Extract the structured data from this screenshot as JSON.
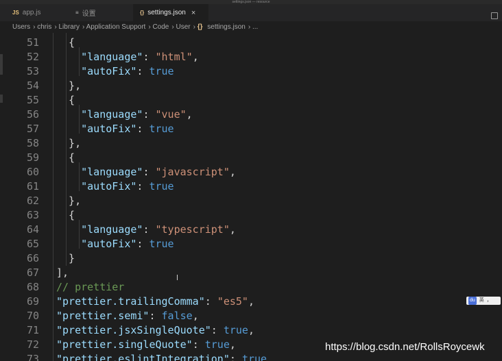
{
  "window": {
    "title": "settings.json — resource"
  },
  "tabs": [
    {
      "icon": "JS",
      "label": "app.js"
    },
    {
      "icon": "≡",
      "label": "设置"
    },
    {
      "icon": "{}",
      "label": "settings.json",
      "close": "×"
    }
  ],
  "breadcrumb": [
    "Users",
    "chris",
    "Library",
    "Application Support",
    "Code",
    "User",
    "settings.json",
    "..."
  ],
  "code": [
    {
      "n": "51",
      "t": [
        [
          "p",
          "  {"
        ]
      ]
    },
    {
      "n": "52",
      "t": [
        [
          "k",
          "    \"language\""
        ],
        [
          "p",
          ": "
        ],
        [
          "s",
          "\"html\""
        ],
        [
          "p",
          ","
        ]
      ]
    },
    {
      "n": "53",
      "t": [
        [
          "k",
          "    \"autoFix\""
        ],
        [
          "p",
          ": "
        ],
        [
          "b",
          "true"
        ]
      ]
    },
    {
      "n": "54",
      "t": [
        [
          "p",
          "  },"
        ]
      ]
    },
    {
      "n": "55",
      "t": [
        [
          "p",
          "  {"
        ]
      ]
    },
    {
      "n": "56",
      "t": [
        [
          "k",
          "    \"language\""
        ],
        [
          "p",
          ": "
        ],
        [
          "s",
          "\"vue\""
        ],
        [
          "p",
          ","
        ]
      ]
    },
    {
      "n": "57",
      "t": [
        [
          "k",
          "    \"autoFix\""
        ],
        [
          "p",
          ": "
        ],
        [
          "b",
          "true"
        ]
      ]
    },
    {
      "n": "58",
      "t": [
        [
          "p",
          "  },"
        ]
      ]
    },
    {
      "n": "59",
      "t": [
        [
          "p",
          "  {"
        ]
      ]
    },
    {
      "n": "60",
      "t": [
        [
          "k",
          "    \"language\""
        ],
        [
          "p",
          ": "
        ],
        [
          "s",
          "\"javascript\""
        ],
        [
          "p",
          ","
        ]
      ]
    },
    {
      "n": "61",
      "t": [
        [
          "k",
          "    \"autoFix\""
        ],
        [
          "p",
          ": "
        ],
        [
          "b",
          "true"
        ]
      ]
    },
    {
      "n": "62",
      "t": [
        [
          "p",
          "  },"
        ]
      ]
    },
    {
      "n": "63",
      "t": [
        [
          "p",
          "  {"
        ]
      ]
    },
    {
      "n": "64",
      "t": [
        [
          "k",
          "    \"language\""
        ],
        [
          "p",
          ": "
        ],
        [
          "s",
          "\"typescript\""
        ],
        [
          "p",
          ","
        ]
      ]
    },
    {
      "n": "65",
      "t": [
        [
          "k",
          "    \"autoFix\""
        ],
        [
          "p",
          ": "
        ],
        [
          "b",
          "true"
        ]
      ]
    },
    {
      "n": "66",
      "t": [
        [
          "p",
          "  }"
        ]
      ]
    },
    {
      "n": "67",
      "t": [
        [
          "p",
          "],"
        ]
      ]
    },
    {
      "n": "68",
      "t": [
        [
          "c",
          "// prettier"
        ]
      ]
    },
    {
      "n": "69",
      "t": [
        [
          "k",
          "\"prettier.trailingComma\""
        ],
        [
          "p",
          ": "
        ],
        [
          "s",
          "\"es5\""
        ],
        [
          "p",
          ","
        ]
      ]
    },
    {
      "n": "70",
      "t": [
        [
          "k",
          "\"prettier.semi\""
        ],
        [
          "p",
          ": "
        ],
        [
          "b",
          "false"
        ],
        [
          "p",
          ","
        ]
      ]
    },
    {
      "n": "71",
      "t": [
        [
          "k",
          "\"prettier.jsxSingleQuote\""
        ],
        [
          "p",
          ": "
        ],
        [
          "b",
          "true"
        ],
        [
          "p",
          ","
        ]
      ]
    },
    {
      "n": "72",
      "t": [
        [
          "k",
          "\"prettier.singleQuote\""
        ],
        [
          "p",
          ": "
        ],
        [
          "b",
          "true"
        ],
        [
          "p",
          ","
        ]
      ]
    },
    {
      "n": "73",
      "t": [
        [
          "k",
          "\"prettier.eslintIntegration\""
        ],
        [
          "p",
          ": "
        ],
        [
          "b",
          "true"
        ]
      ]
    }
  ],
  "ime": {
    "badge": "du",
    "lang": "英",
    "punct": "，"
  },
  "watermark": "https://blog.csdn.net/RollsRoycewk",
  "colors": {
    "key": "#9cdcfe",
    "string": "#ce9178",
    "boolean": "#569cd6",
    "comment": "#6a9955"
  }
}
